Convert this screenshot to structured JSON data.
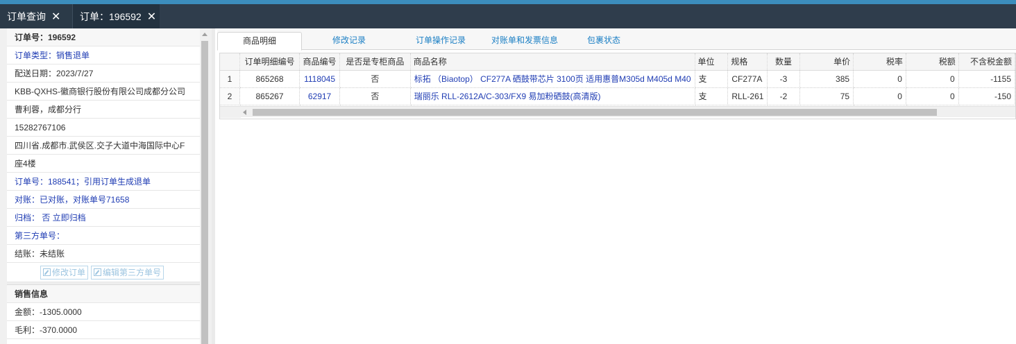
{
  "tabs": [
    {
      "label": "订单查询"
    },
    {
      "label": "订单：196592"
    }
  ],
  "left_panel": {
    "order_info": {
      "heading": "订单号：196592",
      "order_type": "订单类型：销售退单",
      "delivery_date": "配送日期：2023/7/27",
      "customer": "KBB-QXHS-徽商银行股份有限公司成都分公司",
      "contact": "曹利蓉，成都分行",
      "phone": "15282767106",
      "address_line1": "四川省.成都市.武侯区.交子大道中海国际中心F",
      "address_line2": "座4楼",
      "ref_order": "订单号：188541；引用订单生成退单",
      "reconcile": "对账：已对账，对账单号71658",
      "archive": "归档： 否 立即归档",
      "third_party": "第三方单号：",
      "settlement": "结账：未结账",
      "edit_order_btn": "修改订单",
      "edit_third_party_btn": "编辑第三方单号"
    },
    "sales_info": {
      "heading": "销售信息",
      "amount": "金额：-1305.0000",
      "gross_profit": "毛利：-370.0000"
    }
  },
  "subtabs": [
    {
      "label": "商品明细"
    },
    {
      "label": "修改记录"
    },
    {
      "label": "订单操作记录"
    },
    {
      "label": "对账单和发票信息"
    },
    {
      "label": "包裹状态"
    }
  ],
  "grid": {
    "columns": [
      "订单明细编号",
      "商品编号",
      "是否是专柜商品",
      "商品名称",
      "单位",
      "规格",
      "数量",
      "单价",
      "税率",
      "税额",
      "不含税金额"
    ],
    "rows": [
      {
        "rn": "1",
        "detail_id": "865268",
        "product_id": "1118045",
        "counter": "否",
        "name": "标拓 （Biaotop） CF277A 硒鼓带芯片 3100页 适用惠普M305d M405d M40",
        "unit": "支",
        "spec": "CF277A",
        "qty": "-3",
        "price": "385",
        "tax_rate": "0",
        "tax": "0",
        "net": "-1155"
      },
      {
        "rn": "2",
        "detail_id": "865267",
        "product_id": "62917",
        "counter": "否",
        "name": "瑞丽乐 RLL-2612A/C-303/FX9 易加粉硒鼓(高清版)",
        "unit": "支",
        "spec": "RLL-261",
        "qty": "-2",
        "price": "75",
        "tax_rate": "0",
        "tax": "0",
        "net": "-150"
      }
    ]
  },
  "colors": {
    "accent": "#3c8dbc",
    "tabbar": "#2f3d4c",
    "link": "#1f3cb3",
    "subtab_link": "#1b7fc4"
  }
}
